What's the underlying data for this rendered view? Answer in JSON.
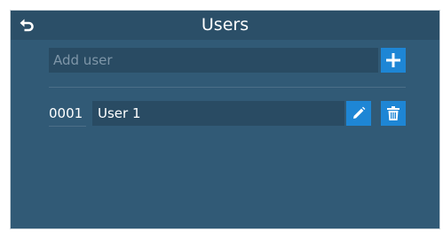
{
  "header": {
    "title": "Users",
    "back_icon": "back-arrow-icon"
  },
  "add_user": {
    "placeholder": "Add user",
    "value": "",
    "button_icon": "plus-icon"
  },
  "users": [
    {
      "id": "0001",
      "name": "User 1",
      "edit_icon": "pencil-icon",
      "delete_icon": "trash-icon"
    }
  ],
  "colors": {
    "background": "#315a76",
    "header": "#2b4f68",
    "field": "#294b63",
    "accent": "#1e86d5",
    "placeholder": "#7e96a8",
    "text": "#ffffff"
  }
}
